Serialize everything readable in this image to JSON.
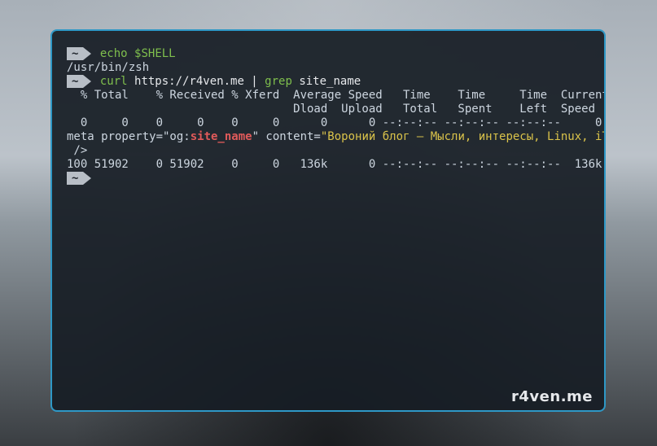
{
  "prompt": {
    "home": "~"
  },
  "cmd1": {
    "echo": "echo",
    "var": "$SHELL"
  },
  "out1": "/usr/bin/zsh",
  "cmd2": {
    "curl": "curl",
    "url": " https://r4ven.me | ",
    "grep": "grep",
    "arg": " site_name"
  },
  "curl_header1": "  % Total    % Received % Xferd  Average Speed   Time    Time     Time  Current",
  "curl_header2": "                                 Dload  Upload   Total   Spent    Left  Speed",
  "curl_row1": "  0     0    0     0    0     0      0      0 --:--:-- --:--:-- --:--:--     0 <",
  "meta": {
    "pre": "meta property=\"og:",
    "name": "site_name",
    "mid": "\" content=",
    "val": "\"Вороний блог – Мысли, интересы, Linux, iT\"",
    "post": " />"
  },
  "curl_row2": "100 51902    0 51902    0     0   136k      0 --:--:-- --:--:-- --:--:--  136k",
  "watermark": "r4ven.me"
}
